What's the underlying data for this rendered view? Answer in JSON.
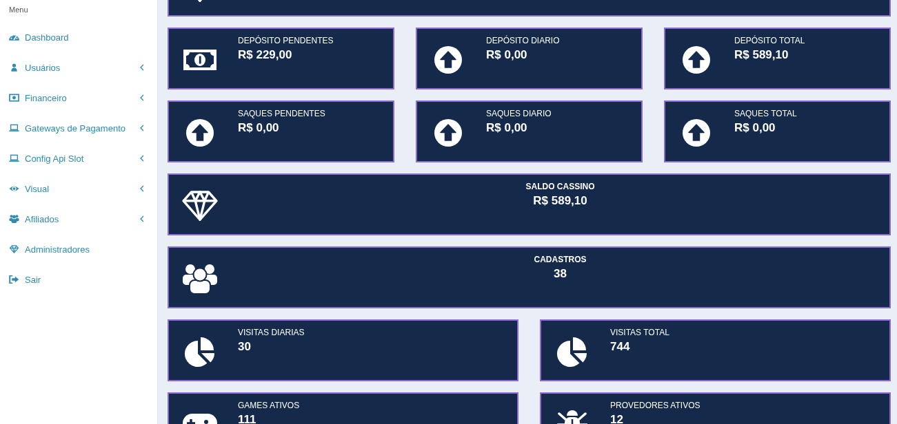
{
  "sidebar": {
    "heading": "Menu",
    "items": [
      {
        "label": "Dashboard",
        "kind": "link"
      },
      {
        "label": "Usuários",
        "kind": "submenu"
      },
      {
        "label": "Financeiro",
        "kind": "submenu"
      },
      {
        "label": "Gateways de Pagamento",
        "kind": "submenu"
      },
      {
        "label": "Config Api Slot",
        "kind": "submenu"
      },
      {
        "label": "Visual",
        "kind": "submenu"
      },
      {
        "label": "Afiliados",
        "kind": "submenu"
      },
      {
        "label": "Administradores",
        "kind": "link"
      },
      {
        "label": "Sair",
        "kind": "link"
      }
    ]
  },
  "stats": {
    "rows": [
      {
        "cards": [
          {
            "kind": "centered"
          }
        ]
      },
      {
        "cards": [
          {
            "kind": "standard",
            "title": "DEPÓSITO PENDENTES",
            "value": "R$ 229,00"
          },
          {
            "kind": "standard",
            "title": "DEPÓSITO DIARIO",
            "value": "R$ 0,00"
          },
          {
            "kind": "standard",
            "title": "DEPÓSITO TOTAL",
            "value": "R$ 589,10"
          }
        ]
      },
      {
        "cards": [
          {
            "kind": "standard",
            "title": "SAQUES PENDENTES",
            "value": "R$ 0,00"
          },
          {
            "kind": "standard",
            "title": "SAQUES DIARIO",
            "value": "R$ 0,00"
          },
          {
            "kind": "standard",
            "title": "SAQUES TOTAL",
            "value": "R$ 0,00"
          }
        ]
      },
      {
        "cards": [
          {
            "kind": "centered",
            "title": "SALDO CASSINO",
            "value": "R$ 589,10"
          }
        ]
      },
      {
        "cards": [
          {
            "kind": "centered",
            "title": "CADASTROS",
            "value": "38"
          }
        ]
      },
      {
        "cards": [
          {
            "kind": "standard",
            "title": "VISITAS DIARIAS",
            "value": "30"
          },
          {
            "kind": "standard",
            "title": "VISITAS TOTAL",
            "value": "744"
          }
        ]
      },
      {
        "cards": [
          {
            "kind": "standard",
            "title": "GAMES ATIVOS",
            "value": "111"
          },
          {
            "kind": "standard",
            "title": "PROVEDORES ATIVOS",
            "value": "12"
          }
        ]
      }
    ]
  }
}
